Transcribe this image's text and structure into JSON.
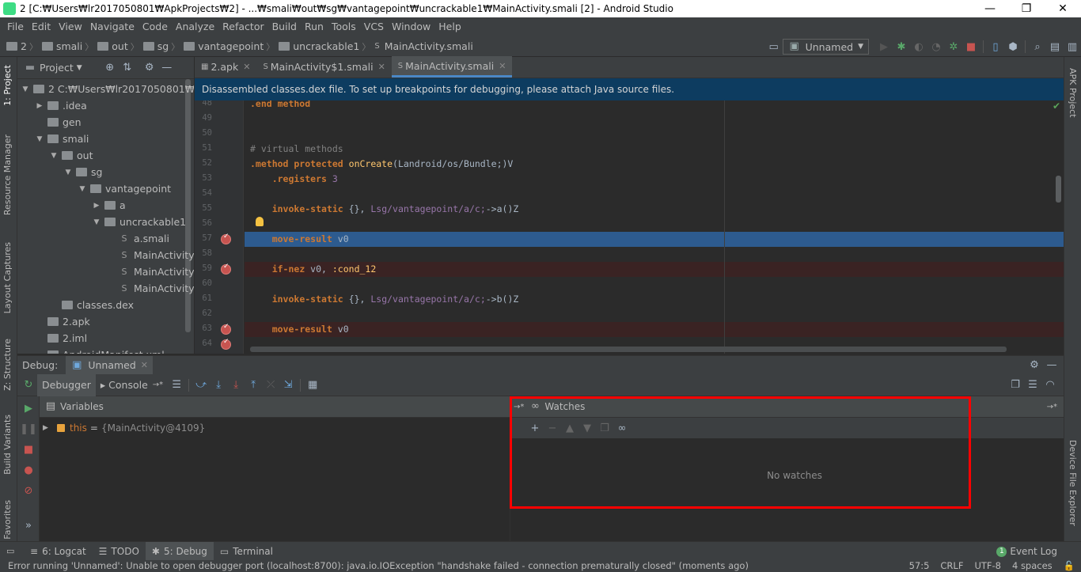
{
  "window": {
    "title": "2 [C:₩Users₩lr2017050801₩ApkProjects₩2] - ...₩smali₩out₩sg₩vantagepoint₩uncrackable1₩MainActivity.smali [2] - Android Studio",
    "minimize": "—",
    "restore": "❐",
    "close": "✕"
  },
  "menu": [
    "File",
    "Edit",
    "View",
    "Navigate",
    "Code",
    "Analyze",
    "Refactor",
    "Build",
    "Run",
    "Tools",
    "VCS",
    "Window",
    "Help"
  ],
  "breadcrumb": [
    "2",
    "smali",
    "out",
    "sg",
    "vantagepoint",
    "uncrackable1",
    "MainActivity.smali"
  ],
  "breadcrumb_smali_marker": "S",
  "run_config": "Unnamed",
  "project": {
    "title": "Project",
    "tree": [
      {
        "label": "2  C:₩Users₩lr2017050801₩ApkP",
        "depth": 0,
        "toggle": "▼",
        "kind": "folder"
      },
      {
        "label": ".idea",
        "depth": 1,
        "toggle": "▶",
        "kind": "folder"
      },
      {
        "label": "gen",
        "depth": 1,
        "toggle": "",
        "kind": "folder"
      },
      {
        "label": "smali",
        "depth": 1,
        "toggle": "▼",
        "kind": "folder"
      },
      {
        "label": "out",
        "depth": 2,
        "toggle": "▼",
        "kind": "folder"
      },
      {
        "label": "sg",
        "depth": 3,
        "toggle": "▼",
        "kind": "folder"
      },
      {
        "label": "vantagepoint",
        "depth": 4,
        "toggle": "▼",
        "kind": "folder"
      },
      {
        "label": "a",
        "depth": 5,
        "toggle": "▶",
        "kind": "folder"
      },
      {
        "label": "uncrackable1",
        "depth": 5,
        "toggle": "▼",
        "kind": "folder"
      },
      {
        "label": "a.smali",
        "depth": 6,
        "toggle": "",
        "kind": "smali"
      },
      {
        "label": "MainActivity$",
        "depth": 6,
        "toggle": "",
        "kind": "smali"
      },
      {
        "label": "MainActivity$",
        "depth": 6,
        "toggle": "",
        "kind": "smali"
      },
      {
        "label": "MainActivity.s",
        "depth": 6,
        "toggle": "",
        "kind": "smali"
      },
      {
        "label": "classes.dex",
        "depth": 2,
        "toggle": "",
        "kind": "folder"
      },
      {
        "label": "2.apk",
        "depth": 1,
        "toggle": "",
        "kind": "folder"
      },
      {
        "label": "2.iml",
        "depth": 1,
        "toggle": "",
        "kind": "folder"
      },
      {
        "label": "AndroidManifest.xml",
        "depth": 1,
        "toggle": "",
        "kind": "folder"
      }
    ]
  },
  "tabs": [
    {
      "label": "2.apk",
      "active": false,
      "icon": ""
    },
    {
      "label": "MainActivity$1.smali",
      "active": false,
      "icon": "S"
    },
    {
      "label": "MainActivity.smali",
      "active": true,
      "icon": "S"
    }
  ],
  "tab_close": "✕",
  "banner": "Disassembled classes.dex file. To set up breakpoints for debugging, please attach Java source files.",
  "code_lines": [
    {
      "n": "48",
      "html": "<span class='kw'>.end method</span>",
      "bp": false,
      "hl": ""
    },
    {
      "n": "49",
      "html": "",
      "bp": false,
      "hl": ""
    },
    {
      "n": "50",
      "html": "",
      "bp": false,
      "hl": ""
    },
    {
      "n": "51",
      "html": "<span class='cm'># virtual methods</span>",
      "bp": false,
      "hl": ""
    },
    {
      "n": "52",
      "html": "<span class='kw'>.method protected</span> <span class='fn'>onCreate</span>(Landroid/os/Bundle;)V",
      "bp": false,
      "hl": ""
    },
    {
      "n": "53",
      "html": "    <span class='kw'>.registers</span> <span class='lb'>3</span>",
      "bp": false,
      "hl": ""
    },
    {
      "n": "54",
      "html": "",
      "bp": false,
      "hl": ""
    },
    {
      "n": "55",
      "html": "    <span class='kw'>invoke-static</span> {}, <span class='lb'>Lsg/vantagepoint/a/c;</span>-&gt;a()Z",
      "bp": false,
      "hl": ""
    },
    {
      "n": "56",
      "html": "",
      "bp": false,
      "hl": ""
    },
    {
      "n": "57",
      "html": "    <span class='kw'>move-result</span> v0",
      "bp": true,
      "hl": "exec"
    },
    {
      "n": "58",
      "html": "",
      "bp": false,
      "hl": ""
    },
    {
      "n": "59",
      "html": "    <span class='kw'>if-nez</span> v0, <span class='fn'>:cond_12</span>",
      "bp": true,
      "hl": "bp"
    },
    {
      "n": "60",
      "html": "",
      "bp": false,
      "hl": ""
    },
    {
      "n": "61",
      "html": "    <span class='kw'>invoke-static</span> {}, <span class='lb'>Lsg/vantagepoint/a/c;</span>-&gt;b()Z",
      "bp": false,
      "hl": ""
    },
    {
      "n": "62",
      "html": "",
      "bp": false,
      "hl": ""
    },
    {
      "n": "63",
      "html": "    <span class='kw'>move-result</span> v0",
      "bp": true,
      "hl": "bp"
    },
    {
      "n": "64",
      "html": "",
      "bp": true,
      "hl": ""
    }
  ],
  "debug": {
    "label": "Debug:",
    "session": "Unnamed",
    "tab_debugger": "Debugger",
    "tab_console": "Console",
    "variables_title": "Variables",
    "var_name": "this",
    "var_eq": "=",
    "var_value": "{MainActivity@4109}",
    "watches_title": "Watches",
    "no_watches": "No watches"
  },
  "left_tools": [
    "1: Project",
    "Resource Manager",
    "Layout Captures",
    "Z: Structure",
    "Build Variants",
    "Favorites"
  ],
  "right_tools": [
    "APK Project",
    "Device File Explorer"
  ],
  "bottom_tabs": [
    {
      "label": "6: Logcat",
      "icon": "≡",
      "active": false
    },
    {
      "label": "TODO",
      "icon": "☰",
      "active": false
    },
    {
      "label": "5: Debug",
      "icon": "✱",
      "active": true
    },
    {
      "label": "Terminal",
      "icon": "▭",
      "active": false
    }
  ],
  "event_log": "Event Log",
  "event_count": "1",
  "status": {
    "message": "Error running 'Unnamed': Unable to open debugger port (localhost:8700): java.io.IOException \"handshake failed - connection prematurally closed\" (moments ago)",
    "position": "57:5",
    "line_sep": "CRLF",
    "encoding": "UTF-8",
    "indent": "4 spaces"
  }
}
